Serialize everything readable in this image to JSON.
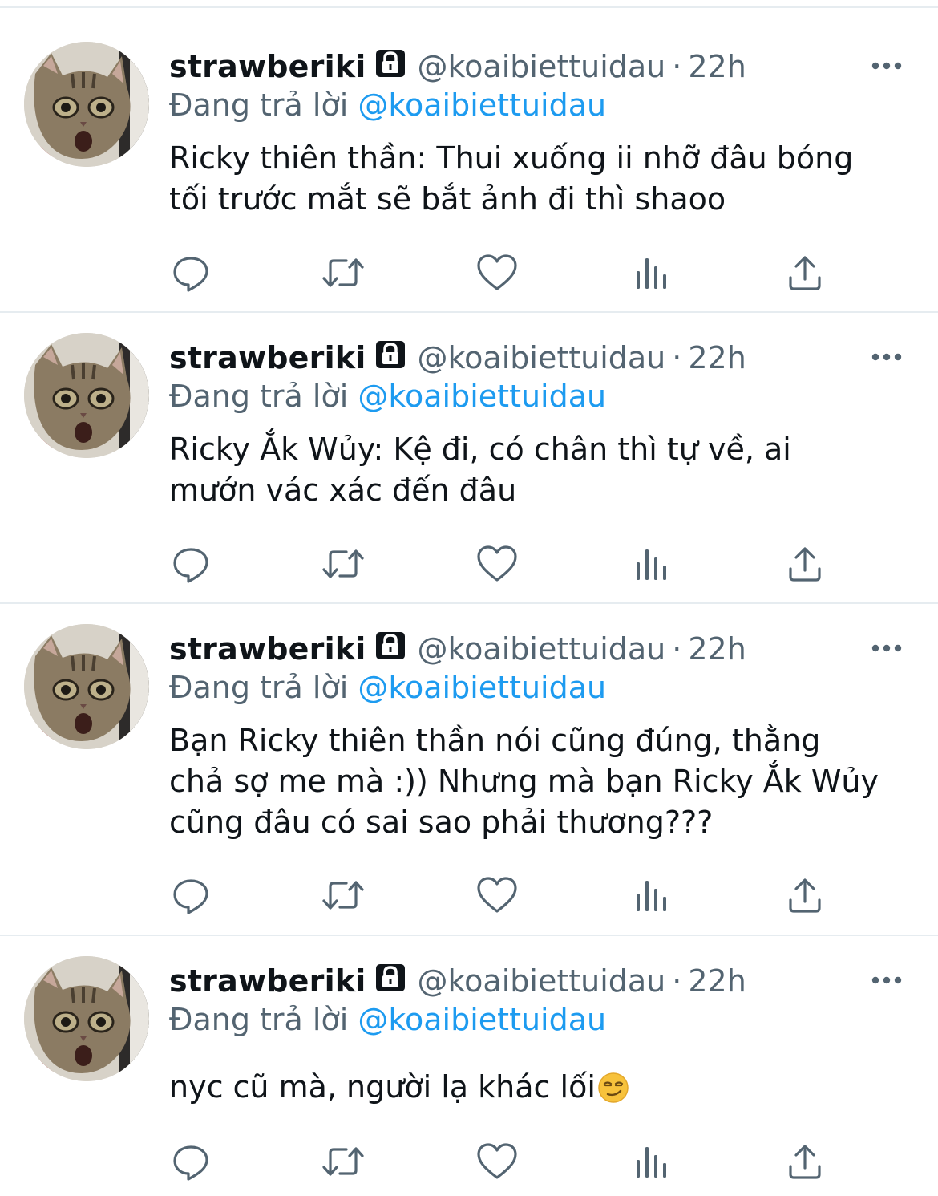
{
  "colors": {
    "text": "#0f1419",
    "secondary": "#536471",
    "accent": "#1d9bf0",
    "divider": "#e6ecf0",
    "icon": "#536471"
  },
  "tweets": [
    {
      "display_name": "strawberiki",
      "handle": "@koaibiettuidau",
      "dot": "·",
      "time": "22h",
      "replying_to_label": "Đang trả lời",
      "replying_to_handle": "@koaibiettuidau",
      "text": "Ricky thiên thần: Thui xuống ii nhỡ đâu bóng\ntối trước mắt sẽ bắt ảnh đi thì shaoo",
      "emoji": ""
    },
    {
      "display_name": "strawberiki",
      "handle": "@koaibiettuidau",
      "dot": "·",
      "time": "22h",
      "replying_to_label": "Đang trả lời",
      "replying_to_handle": "@koaibiettuidau",
      "text": "Ricky Ắk Wủy: Kệ đi, có chân thì tự về, ai\nmướn vác xác đến đâu",
      "emoji": ""
    },
    {
      "display_name": "strawberiki",
      "handle": "@koaibiettuidau",
      "dot": "·",
      "time": "22h",
      "replying_to_label": "Đang trả lời",
      "replying_to_handle": "@koaibiettuidau",
      "text": "Bạn Ricky thiên thần nói cũng đúng, thằng\nchả sợ me mà :)) Nhưng mà bạn Ricky Ắk Wủy\ncũng đâu có sai sao phải thương???",
      "emoji": ""
    },
    {
      "display_name": "strawberiki",
      "handle": "@koaibiettuidau",
      "dot": "·",
      "time": "22h",
      "replying_to_label": "Đang trả lời",
      "replying_to_handle": "@koaibiettuidau",
      "text": "nyc cũ mà, người lạ khác lối",
      "emoji": "smirking-face"
    }
  ],
  "icons": {
    "lock": "lock-icon",
    "more": "more-icon",
    "reply": "reply-icon",
    "retweet": "retweet-icon",
    "like": "like-icon",
    "analytics": "analytics-icon",
    "share": "share-icon"
  }
}
